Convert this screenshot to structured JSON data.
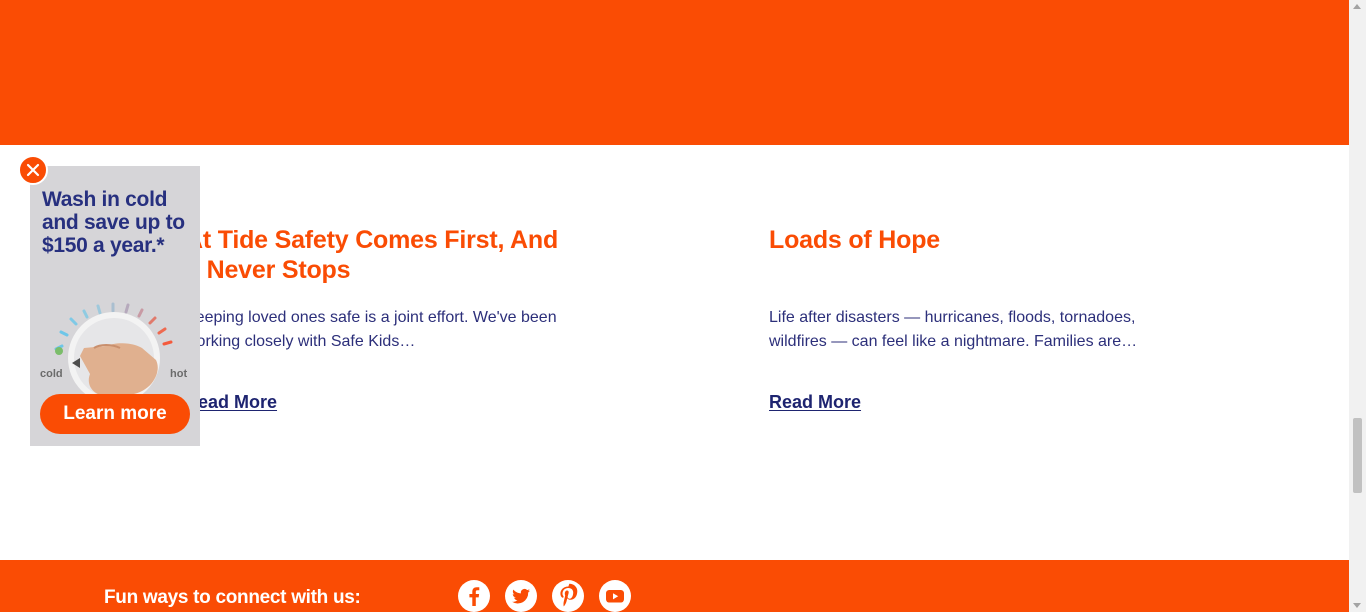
{
  "articles": [
    {
      "title": "At Tide Safety Comes First, And It Never Stops",
      "excerpt": "Keeping loved ones safe is a joint effort. We've been working closely with Safe Kids…",
      "link": "Read More"
    },
    {
      "title": "Loads of Hope",
      "excerpt": "Life after disasters — hurricanes, floods, tornadoes, wildfires — can feel like a nightmare. Families are…",
      "link": "Read More"
    }
  ],
  "ad": {
    "headline": "Wash in cold and save up to $150 a year.*",
    "dial_cold": "cold",
    "dial_hot": "hot",
    "cta": "Learn more"
  },
  "footer": {
    "connect_label": "Fun ways to connect with us:",
    "social": [
      "facebook-icon",
      "twitter-icon",
      "pinterest-icon",
      "youtube-icon"
    ]
  },
  "colors": {
    "brand_orange": "#fa4c04",
    "navy": "#27307f",
    "link_navy": "#1e2470"
  }
}
